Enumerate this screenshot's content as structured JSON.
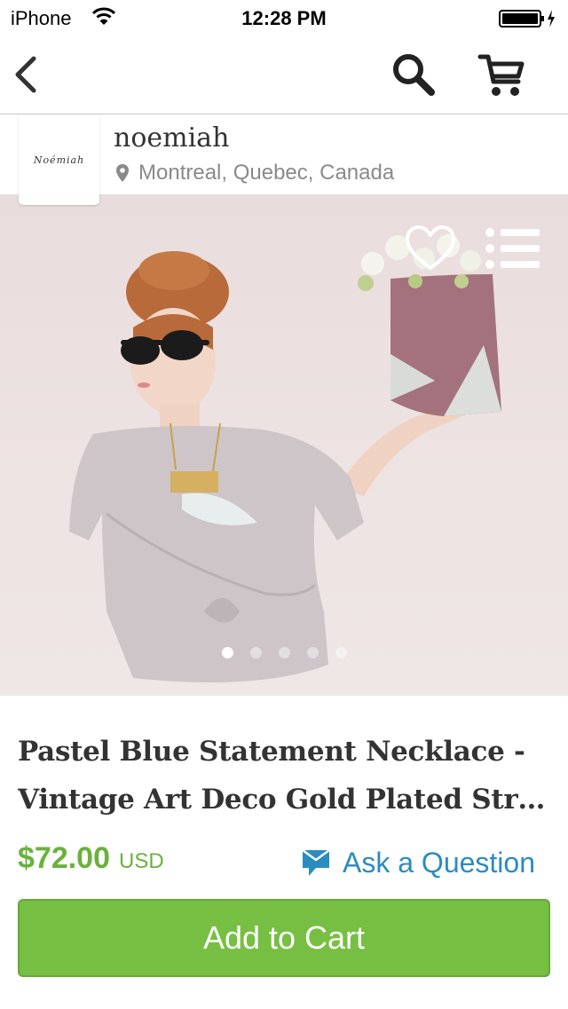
{
  "status_bar": {
    "carrier": "iPhone",
    "time": "12:28 PM"
  },
  "nav": {
    "icons": [
      "back-icon",
      "search-icon",
      "cart-icon"
    ]
  },
  "shop": {
    "logo_text": "Noémiah",
    "name": "noemiah",
    "location": "Montreal, Quebec, Canada"
  },
  "gallery": {
    "image_count": 5,
    "active_index": 0,
    "icons": [
      "heart-icon",
      "list-icon"
    ]
  },
  "product": {
    "title_line1": "Pastel Blue Statement Necklace -",
    "title_line2": "Vintage Art Deco Gold Plated Struct…",
    "price": "$72.00",
    "currency": "USD"
  },
  "actions": {
    "ask_question_label": "Ask a Question",
    "add_to_cart_label": "Add to Cart"
  },
  "colors": {
    "accent_green": "#77bf42",
    "price_green": "#6bb13d",
    "link_blue": "#2b8cbf"
  }
}
